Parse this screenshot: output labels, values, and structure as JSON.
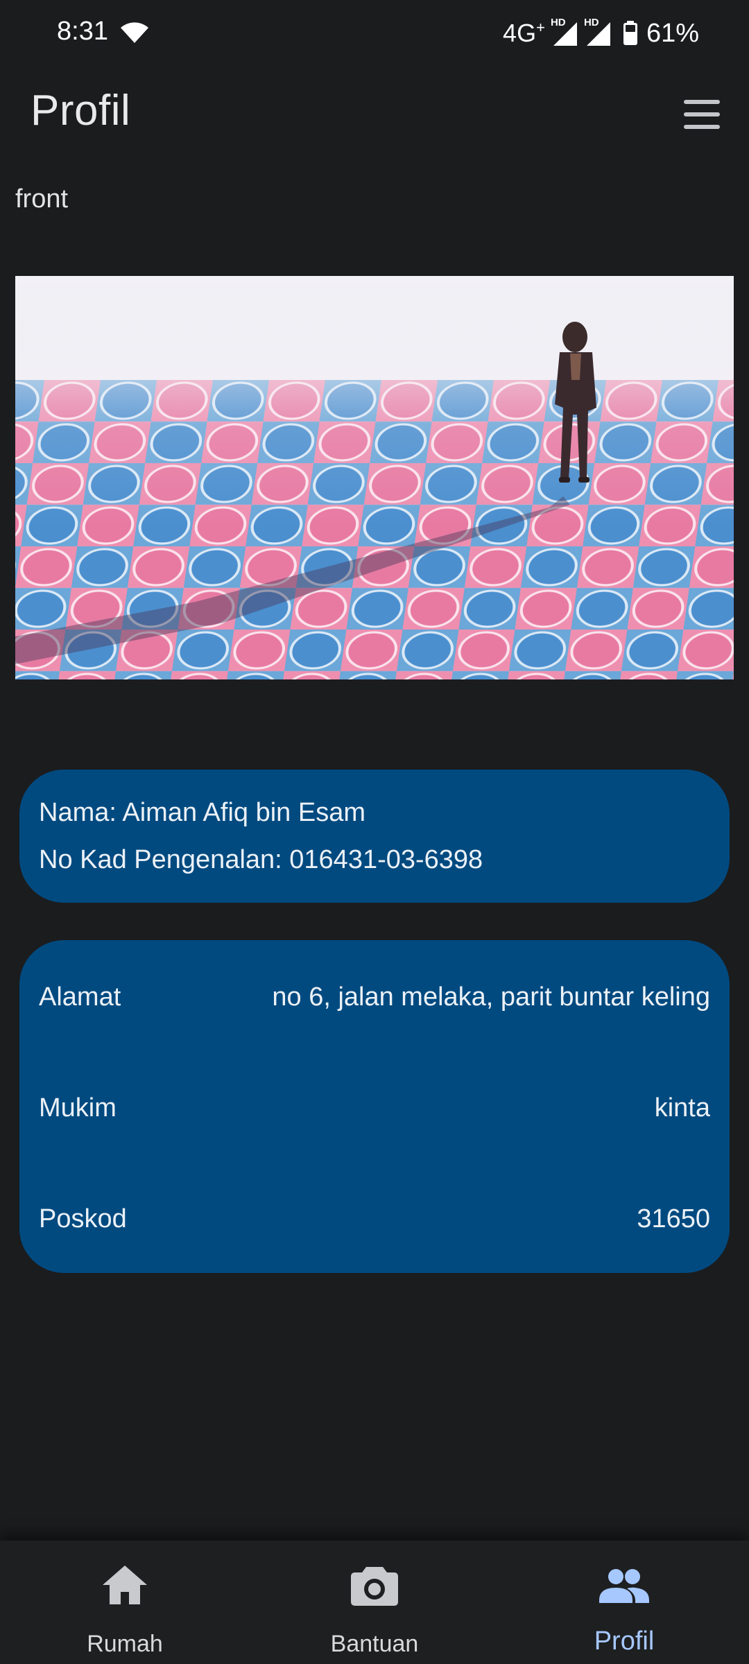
{
  "status_bar": {
    "time": "8:31",
    "network": "4G",
    "network_suffix": "+",
    "hd_label_1": "HD",
    "hd_label_2": "HD",
    "battery": "61%"
  },
  "app_bar": {
    "title": "Profil",
    "menu_icon": "hamburger-menu-icon"
  },
  "image_section": {
    "caption": "front"
  },
  "identity_card": {
    "name_line": "Nama: Aiman Afiq bin Esam",
    "ic_line": "No Kad Pengenalan: 016431-03-6398"
  },
  "address_card": {
    "rows": [
      {
        "label": "Alamat",
        "value": "no 6, jalan melaka, parit buntar keling"
      },
      {
        "label": "Mukim",
        "value": "kinta"
      },
      {
        "label": "Poskod",
        "value": "31650"
      }
    ]
  },
  "bottom_nav": {
    "items": [
      {
        "label": "Rumah",
        "icon": "home-icon",
        "active": false
      },
      {
        "label": "Bantuan",
        "icon": "camera-icon",
        "active": false
      },
      {
        "label": "Profil",
        "icon": "people-icon",
        "active": true
      }
    ]
  },
  "colors": {
    "background": "#1b1c1e",
    "card": "#004a80",
    "active_nav": "#a6c8ff",
    "inactive_nav_icon": "#c8cacd"
  }
}
